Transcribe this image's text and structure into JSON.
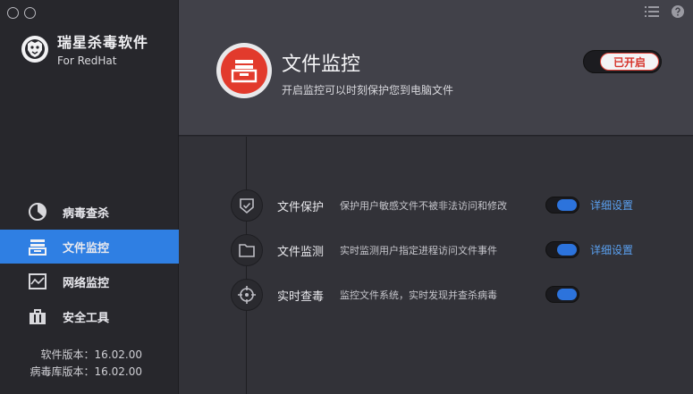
{
  "sidebar": {
    "brand_title": "瑞星杀毒软件",
    "brand_sub": "For RedHat",
    "items": [
      {
        "label": "病毒查杀",
        "icon": "pie-chart-icon",
        "active": false
      },
      {
        "label": "文件监控",
        "icon": "file-tray-icon",
        "active": true
      },
      {
        "label": "网络监控",
        "icon": "network-monitor-icon",
        "active": false
      },
      {
        "label": "安全工具",
        "icon": "toolbox-icon",
        "active": false
      }
    ],
    "software_version": "软件版本：16.02.00",
    "virus_db_version": "病毒库版本：16.02.00"
  },
  "header": {
    "title": "文件监控",
    "subtitle": "开启监控可以时刻保护您到电脑文件",
    "toggle_label": "已开启"
  },
  "rows": [
    {
      "title": "文件保护",
      "desc": "保护用户敏感文件不被非法访问和修改",
      "link": "详细设置",
      "icon": "shield-check-icon"
    },
    {
      "title": "文件监测",
      "desc": "实时监测用户指定进程访问文件事件",
      "link": "详细设置",
      "icon": "folder-icon"
    },
    {
      "title": "实时查毒",
      "desc": "监控文件系统，实时发现并查杀病毒",
      "link": "",
      "icon": "crosshair-icon"
    }
  ],
  "colors": {
    "accent": "#2f7fe3",
    "brand_red": "#e23a2c",
    "link": "#5aa0f0"
  }
}
